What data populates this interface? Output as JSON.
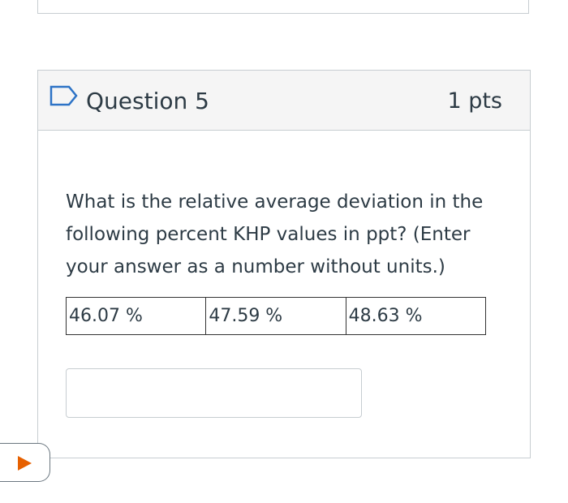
{
  "question": {
    "title": "Question 5",
    "points": "1 pts",
    "text": "What is the relative average deviation in the following percent KHP values in ppt?  (Enter your answer as a number without units.)",
    "values": [
      "46.07 %",
      "47.59 %",
      "48.63 %"
    ],
    "answer": {
      "value": "",
      "placeholder": ""
    }
  },
  "icons": {
    "flag": "flag-icon",
    "play": "play-icon"
  },
  "colors": {
    "border": "#c7cdd1",
    "header_bg": "#f5f5f5",
    "text": "#2d3b45",
    "play_accent": "#e66000"
  }
}
